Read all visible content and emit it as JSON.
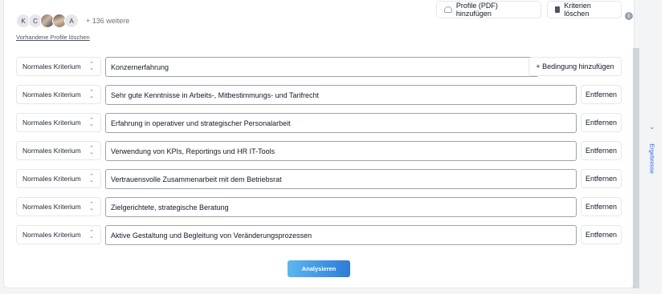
{
  "profiles": {
    "avatars": [
      "K",
      "C",
      "",
      "",
      "A"
    ],
    "more_label": "+ 136 weitere",
    "delete_link": "Vorhandene Profile löschen"
  },
  "toolbar": {
    "pdf_button": "Profile (PDF) hinzufügen",
    "clear_button": "Kriterien löschen",
    "info_icon": "info-icon"
  },
  "criteria": [
    {
      "type": "Normales Kriterium",
      "text": "Konzernerfahrung",
      "action": "+ Bedingung hinzufügen"
    },
    {
      "type": "Normales Kriterium",
      "text": "Sehr gute Kenntnisse in Arbeits-, Mitbestimmungs- und Tarifrecht",
      "action": "Entfernen"
    },
    {
      "type": "Normales Kriterium",
      "text": "Erfahrung in operativer und strategischer Personalarbeit",
      "action": "Entfernen"
    },
    {
      "type": "Normales Kriterium",
      "text": "Verwendung von KPIs, Reportings und HR IT-Tools",
      "action": "Entfernen"
    },
    {
      "type": "Normales Kriterium",
      "text": "Vertrauensvolle Zusammenarbeit mit dem Betriebsrat",
      "action": "Entfernen"
    },
    {
      "type": "Normales Kriterium",
      "text": "Zielgerichtete, strategische Beratung",
      "action": "Entfernen"
    },
    {
      "type": "Normales Kriterium",
      "text": "Aktive Gestaltung und Begleitung von Veränderungsprozessen",
      "action": "Entfernen"
    }
  ],
  "analyze_button": "Analysieren",
  "results_tab": "Ergebnisse",
  "colors": {
    "accent": "#2f7bd6",
    "accent_light": "#5ab8ee"
  }
}
